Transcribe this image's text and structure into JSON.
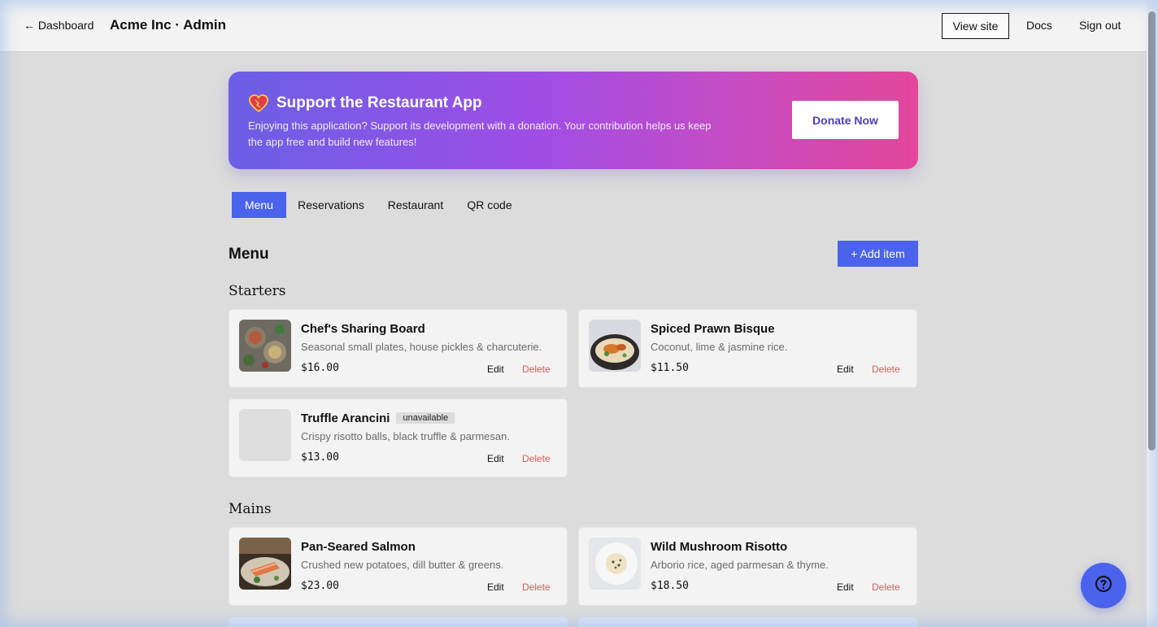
{
  "header": {
    "back_label": "← Dashboard",
    "title": "Acme Inc · Admin",
    "view_site": "View site",
    "docs": "Docs",
    "sign_out": "Sign out"
  },
  "banner": {
    "icon": "heart-icon",
    "title": "Support the Restaurant App",
    "text": "Enjoying this application? Support its development with a donation. Your contribution helps us keep the app free and build new features!",
    "donate_label": "Donate Now",
    "gradient_start": "#6a5fe6",
    "gradient_end": "#e4469a"
  },
  "tabs": [
    {
      "label": "Menu",
      "active": true
    },
    {
      "label": "Reservations",
      "active": false
    },
    {
      "label": "Restaurant",
      "active": false
    },
    {
      "label": "QR code",
      "active": false
    }
  ],
  "menu": {
    "heading": "Menu",
    "add_label": "+ Add item",
    "edit_label": "Edit",
    "delete_label": "Delete",
    "categories": [
      {
        "name": "Starters",
        "items": [
          {
            "name": "Chef's Sharing Board",
            "description": "Seasonal small plates, house pickles & charcuterie.",
            "price": "$16.00",
            "badge": ""
          },
          {
            "name": "Spiced Prawn Bisque",
            "description": "Coconut, lime & jasmine rice.",
            "price": "$11.50",
            "badge": ""
          },
          {
            "name": "Truffle Arancini",
            "description": "Crispy risotto balls, black truffle & parmesan.",
            "price": "$13.00",
            "badge": "unavailable"
          }
        ]
      },
      {
        "name": "Mains",
        "items": [
          {
            "name": "Pan-Seared Salmon",
            "description": "Crushed new potatoes, dill butter & greens.",
            "price": "$23.00",
            "badge": ""
          },
          {
            "name": "Wild Mushroom Risotto",
            "description": "Arborio rice, aged parmesan & thyme.",
            "price": "$18.50",
            "badge": ""
          }
        ]
      }
    ]
  },
  "colors": {
    "accent": "#4a62ec",
    "delete": "#e05a5a"
  },
  "help": {
    "icon": "help-icon"
  }
}
